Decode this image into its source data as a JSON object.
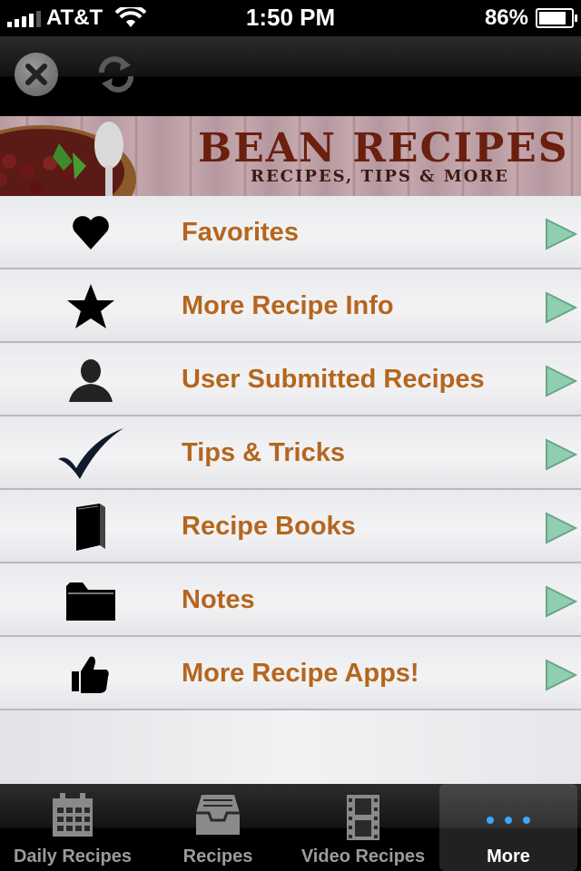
{
  "status_bar": {
    "carrier": "AT&T",
    "time": "1:50 PM",
    "battery_text": "86%",
    "battery_level": 0.86
  },
  "toolbar": {
    "close_icon": "close-icon",
    "refresh_icon": "refresh-icon"
  },
  "banner": {
    "title": "BEAN RECIPES",
    "subtitle": "RECIPES, TIPS & MORE"
  },
  "menu": {
    "items": [
      {
        "label": "Favorites",
        "icon": "heart-icon"
      },
      {
        "label": "More Recipe Info",
        "icon": "star-icon"
      },
      {
        "label": "User Submitted Recipes",
        "icon": "user-icon"
      },
      {
        "label": "Tips & Tricks",
        "icon": "checkmark-icon"
      },
      {
        "label": "Recipe Books",
        "icon": "book-icon"
      },
      {
        "label": "Notes",
        "icon": "folder-icon"
      },
      {
        "label": "More Recipe Apps!",
        "icon": "thumbs-up-icon"
      }
    ],
    "label_color": "#b5661d",
    "arrow_color": "#7fbf9f"
  },
  "tabbar": {
    "tabs": [
      {
        "label": "Daily Recipes",
        "icon": "calendar-icon",
        "active": false
      },
      {
        "label": "Recipes",
        "icon": "inbox-tray-icon",
        "active": false
      },
      {
        "label": "Video Recipes",
        "icon": "film-strip-icon",
        "active": false
      },
      {
        "label": "More",
        "icon": "more-dots-icon",
        "active": true
      }
    ]
  }
}
